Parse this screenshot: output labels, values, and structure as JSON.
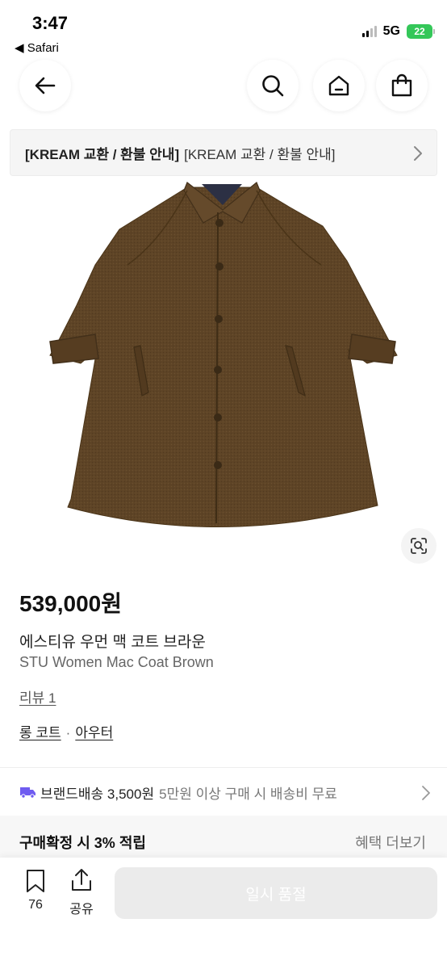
{
  "status_bar": {
    "time": "3:47",
    "back_app": "◀ Safari",
    "network": "5G",
    "battery": "22"
  },
  "nav": {
    "icons": [
      "back-arrow-icon",
      "search-icon",
      "home-icon",
      "shopping-bag-icon"
    ]
  },
  "notice": {
    "title": "[KREAM 교환 / 환불 안내]",
    "text": "[KREAM 교환 / 환불 안내]"
  },
  "product": {
    "price": "539,000원",
    "name_ko": "에스티유 우먼 맥 코트 브라운",
    "name_en": "STU Women Mac Coat Brown",
    "review_link": "리뷰 1",
    "category_primary": "롱 코트",
    "category_separator": "·",
    "category_secondary": "아우터",
    "image_color": "#5e4426"
  },
  "shipping": {
    "label": "브랜드배송 3,500원",
    "condition": "5만원 이상 구매 시 배송비 무료",
    "icon_color": "#6f5cf0"
  },
  "benefit": {
    "title": "구매확정 시 3% 적립",
    "more": "혜택 더보기"
  },
  "bottom": {
    "wish_count": "76",
    "share_label": "공유",
    "soldout_label": "일시 품절"
  }
}
